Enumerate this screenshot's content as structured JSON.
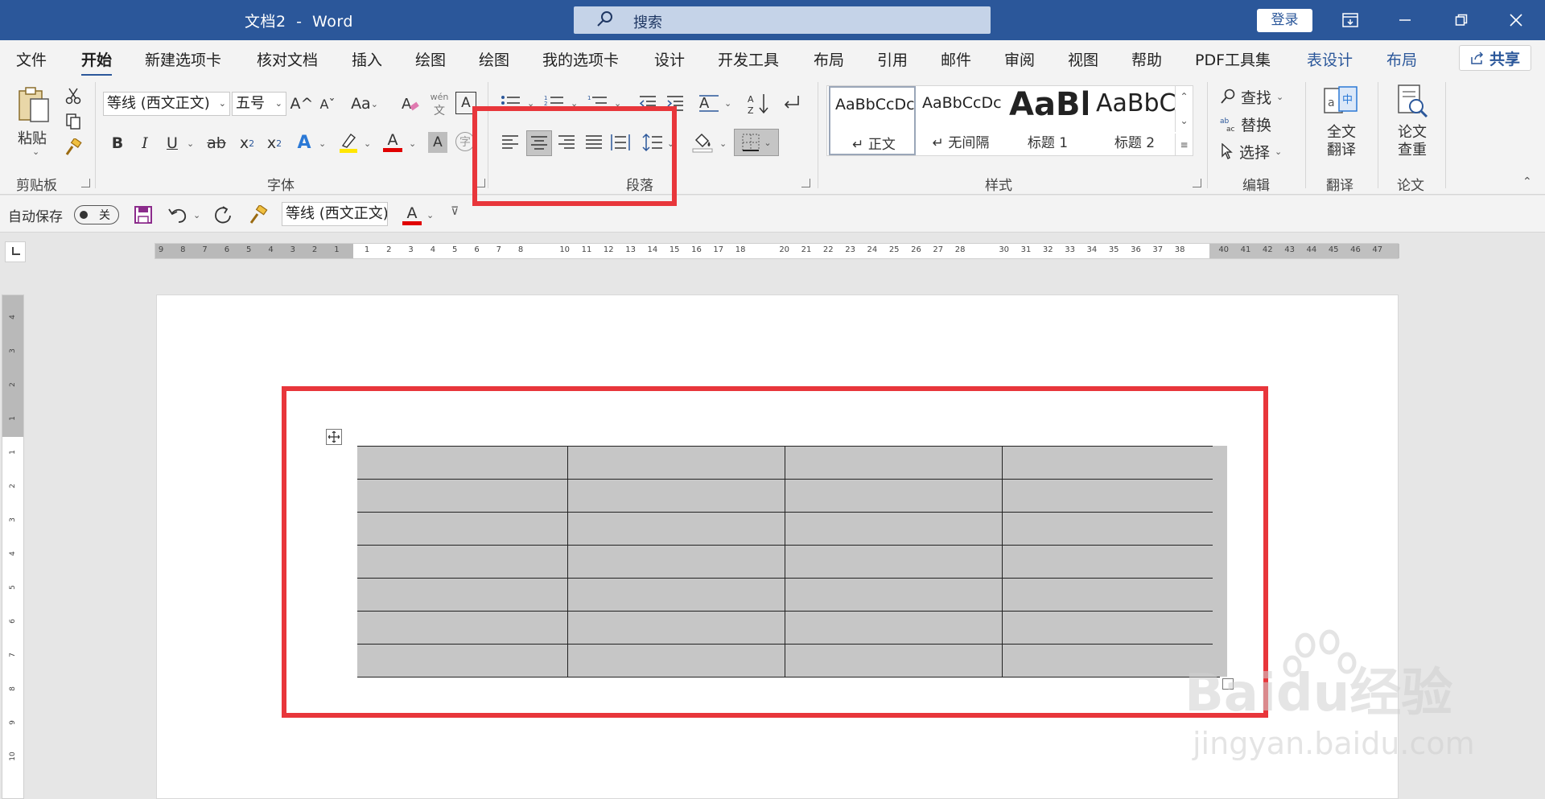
{
  "titlebar": {
    "doc_name": "文档2",
    "separator": "-",
    "app_name": "Word",
    "search_placeholder": "搜索",
    "login_label": "登录"
  },
  "menu": {
    "tabs": [
      "文件",
      "开始",
      "新建选项卡",
      "核对文档",
      "插入",
      "绘图",
      "绘图",
      "我的选项卡",
      "设计",
      "开发工具",
      "布局",
      "引用",
      "邮件",
      "审阅",
      "视图",
      "帮助",
      "PDF工具集",
      "表设计",
      "布局"
    ],
    "active_tab": "开始",
    "share_label": "共享"
  },
  "ribbon": {
    "clipboard": {
      "label": "剪贴板",
      "paste_label": "粘贴"
    },
    "font": {
      "label": "字体",
      "font_name": "等线 (西文正文)",
      "font_size": "五号",
      "case_label": "Aa",
      "pinyin_top": "wén",
      "pinyin_bottom": "文",
      "bold": "B",
      "italic": "I",
      "underline": "U",
      "strike": "ab",
      "subscript": "x",
      "subscript_mark": "2",
      "superscript": "x",
      "superscript_mark": "2",
      "text_effect": "A",
      "font_color": "A",
      "char_shade": "A",
      "enclose": "字"
    },
    "paragraph": {
      "label": "段落"
    },
    "styles": {
      "label": "样式",
      "items": [
        {
          "sample": "AaBbCcDc",
          "name": "↵ 正文"
        },
        {
          "sample": "AaBbCcDc",
          "name": "↵ 无间隔"
        },
        {
          "sample": "AaBl",
          "name": "标题 1"
        },
        {
          "sample": "AaBbC",
          "name": "标题 2"
        }
      ]
    },
    "editing": {
      "label": "编辑",
      "find": "查找",
      "replace": "替换",
      "select": "选择"
    },
    "translate": {
      "label": "翻译",
      "btn_line1": "全文",
      "btn_line2": "翻译"
    },
    "paper": {
      "label": "论文",
      "btn_line1": "论文",
      "btn_line2": "查重"
    }
  },
  "qat": {
    "autosave_label": "自动保存",
    "autosave_state": "关",
    "font_name": "等线 (西文正文)",
    "font_color": "A"
  },
  "ruler": {
    "left_numbers": [
      "9",
      "8",
      "7",
      "6",
      "5",
      "4",
      "3",
      "2",
      "1"
    ],
    "right_numbers": [
      "1",
      "2",
      "3",
      "4",
      "5",
      "6",
      "7",
      "8",
      "10",
      "11",
      "12",
      "13",
      "14",
      "15",
      "16",
      "17",
      "18",
      "20",
      "21",
      "22",
      "23",
      "24",
      "25",
      "26",
      "27",
      "28",
      "30",
      "31",
      "32",
      "33",
      "34",
      "35",
      "36",
      "37",
      "38",
      "40",
      "41",
      "42",
      "43",
      "44",
      "45",
      "46",
      "47"
    ],
    "vertical_numbers": [
      "4",
      "3",
      "2",
      "1",
      "1",
      "2",
      "3",
      "4",
      "5",
      "6",
      "7",
      "8",
      "9",
      "10"
    ]
  },
  "table": {
    "rows": 7,
    "cols": 4
  },
  "watermark": {
    "brand": "Baidu经验",
    "url": "jingyan.baidu.com"
  },
  "colors": {
    "title_bar": "#2b579a",
    "highlight": "#e8363b",
    "table_fill": "#c6c6c6"
  }
}
